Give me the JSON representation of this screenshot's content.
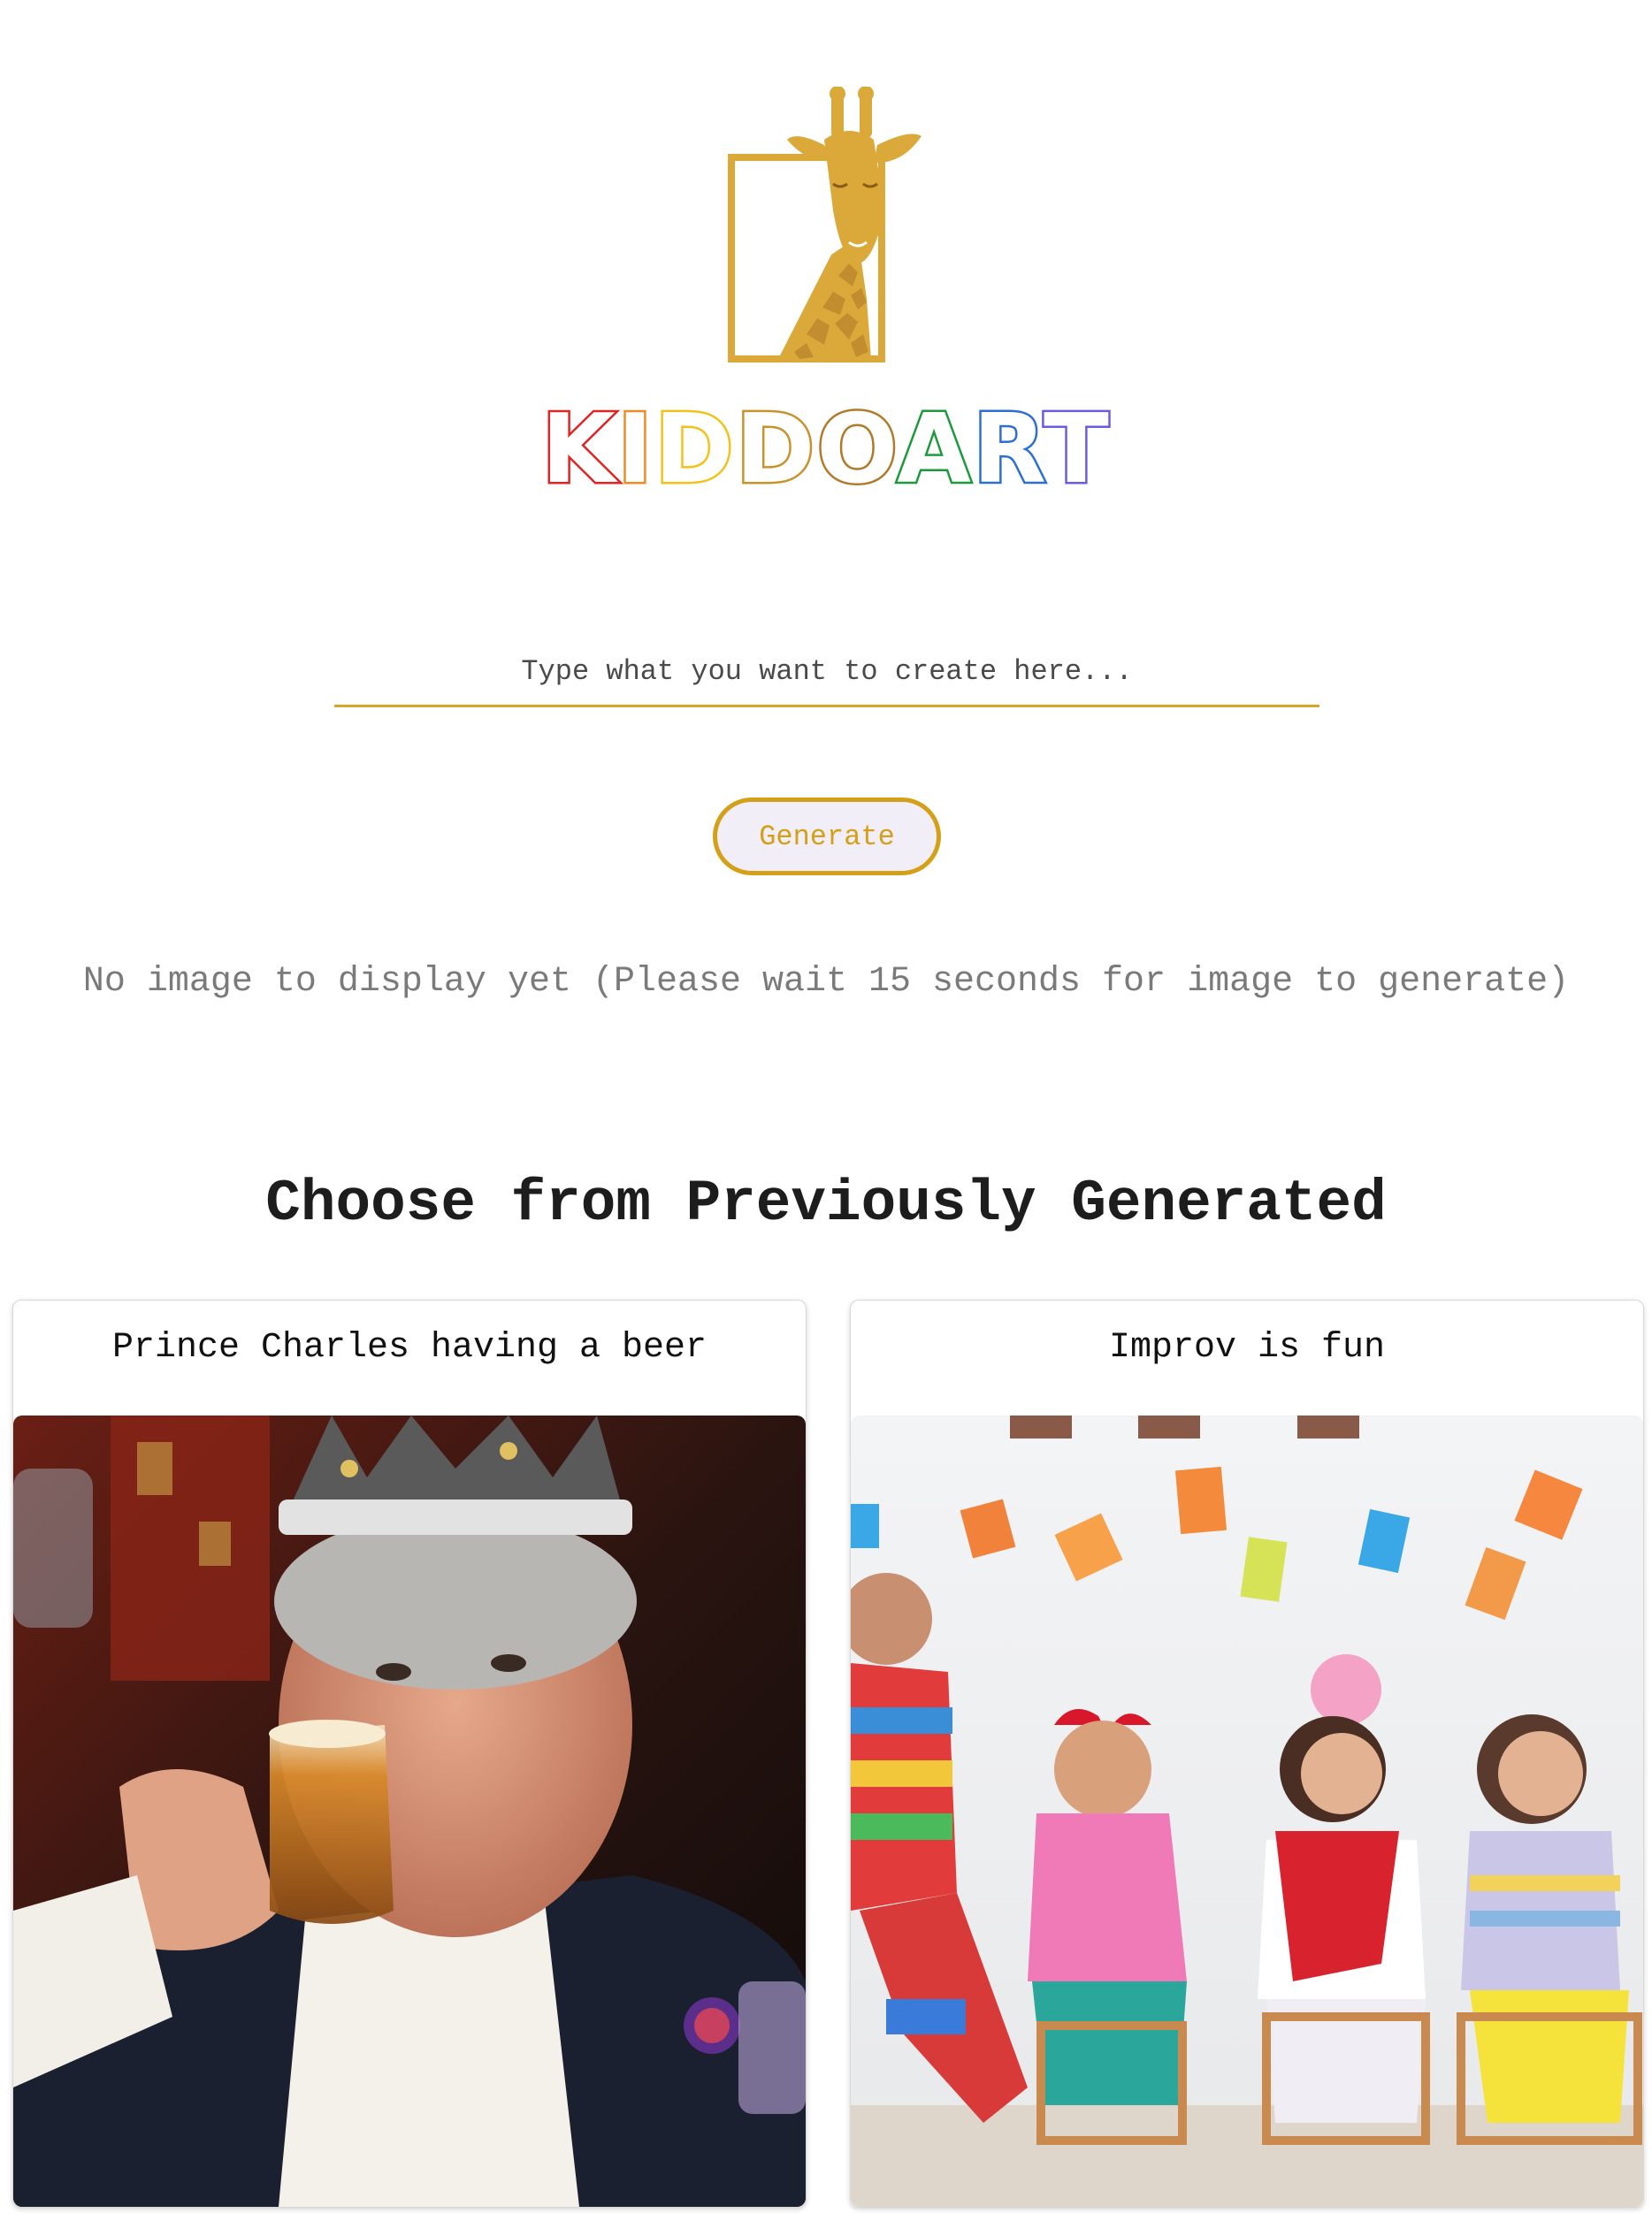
{
  "brand": {
    "letters": [
      "K",
      "I",
      "D",
      "D",
      "O",
      "A",
      "R",
      "T"
    ],
    "accent_color": "#d4a62a"
  },
  "prompt": {
    "placeholder": "Type what you want to create here...",
    "value": ""
  },
  "generate_button": {
    "label": "Generate"
  },
  "status": {
    "text": "No image to display yet (Please wait 15 seconds for image to generate)"
  },
  "gallery": {
    "title": "Choose from Previously Generated",
    "cards": [
      {
        "caption": "Prince Charles having a beer"
      },
      {
        "caption": "Improv is fun"
      }
    ]
  }
}
